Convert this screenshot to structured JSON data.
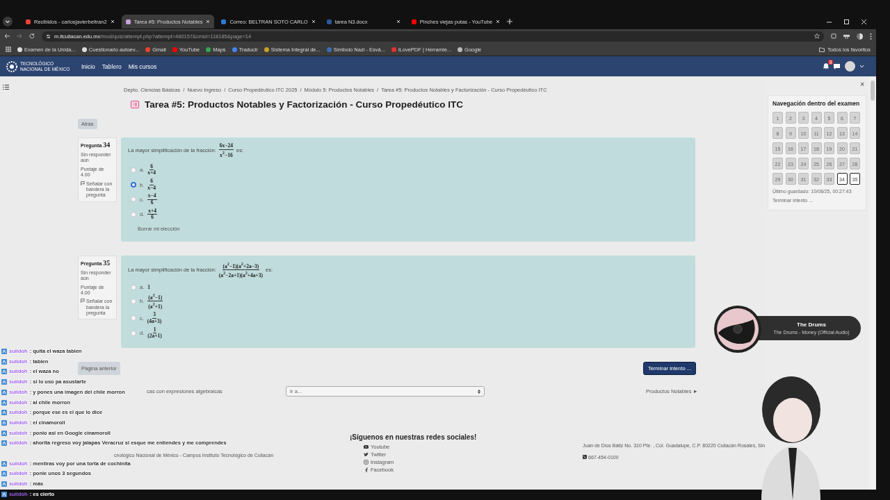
{
  "browser": {
    "tabs": [
      {
        "title": "Recibidos - carlosjavierbeltran2",
        "color": "#ea4335",
        "selected": false
      },
      {
        "title": "Tarea #5: Productos Notables",
        "color": "#c9a0dc",
        "selected": true
      },
      {
        "title": "Correo: BELTRAN SOTO CARLO",
        "color": "#2b7cd3",
        "selected": false
      },
      {
        "title": "tarea N3.docx",
        "color": "#2b579a",
        "selected": false
      },
      {
        "title": "Pinches viejas putas - YouTube",
        "color": "#ff0000",
        "selected": false
      }
    ],
    "url_host": "m.itculiacan.edu.mx",
    "url_path": "/mod/quiz/attempt.php?attempt=480157&cmid=118185&page=14",
    "bookmarks": [
      {
        "label": "Examen de la Unida...",
        "color": "#dddddd"
      },
      {
        "label": "Cuestionario autoev...",
        "color": "#dddddd"
      },
      {
        "label": "Gmail",
        "color": "#ea4335"
      },
      {
        "label": "YouTube",
        "color": "#ff0000"
      },
      {
        "label": "Maps",
        "color": "#34a853"
      },
      {
        "label": "Traducir",
        "color": "#4285f4"
      },
      {
        "label": "Sistema Integral de...",
        "color": "#c8a02a"
      },
      {
        "label": "Símbolo Nazi - Esvá...",
        "color": "#3b6fb6"
      },
      {
        "label": "iLovePDF | Herramie...",
        "color": "#e5322d"
      },
      {
        "label": "Google",
        "color": "#bbbbbb"
      }
    ],
    "all_bookmarks": "Todos los favoritos"
  },
  "site_nav": {
    "logo_text": "TECNOLÓGICO NACIONAL DE MÉXICO",
    "links": [
      "Inicio",
      "Tablero",
      "Mis cursos"
    ],
    "notification_count": "8"
  },
  "breadcrumb": {
    "separator": "/",
    "items": [
      "Depto. Ciencias Básicas",
      "Nuevo Ingreso",
      "Curso Propedéutico ITC 2025",
      "Módulo 5: Productos Notables",
      "Tarea #5: Productos Notables y Factorización - Curso Propedéutico ITC"
    ]
  },
  "page_title": "Tarea #5: Productos Notables y Factorización - Curso Propedéutico ITC",
  "back_button": "Atrás",
  "questions": [
    {
      "label": "Pregunta",
      "number": "34",
      "status": "Sin responder aún",
      "points": "Puntaje de 4.00",
      "flag": "Señalar con bandera la pregunta",
      "prompt": "La mayor simplificación de la fracción:",
      "fraction": {
        "num": "6x−24",
        "den": "x$^{2}$−16"
      },
      "prompt_end": "es:",
      "options": [
        {
          "letter": "a.",
          "kind": "fraction",
          "num": "6",
          "den": "x+4",
          "selected": false
        },
        {
          "letter": "b.",
          "kind": "fraction",
          "num": "6",
          "den": "x−4",
          "selected": true
        },
        {
          "letter": "c.",
          "kind": "fraction",
          "num": "x−4",
          "den": "6",
          "selected": false
        },
        {
          "letter": "d.",
          "kind": "fraction",
          "num": "x+4",
          "den": "6",
          "selected": false
        }
      ],
      "clear_choice": "Borrar mi elección"
    },
    {
      "label": "Pregunta",
      "number": "35",
      "status": "Sin responder aún",
      "points": "Puntaje de 4.00",
      "flag": "Señalar con bandera la pregunta",
      "prompt": "La mayor simplificación de la fracción:",
      "fraction": {
        "num": "(a$^{2}$−1)(a$^{2}$+2a−3)",
        "den": "(a$^{2}$−2a+1)(a$^{2}$+4a+3)"
      },
      "prompt_end": "es:",
      "options": [
        {
          "letter": "a.",
          "kind": "text",
          "text": "1",
          "selected": false
        },
        {
          "letter": "b.",
          "kind": "fraction",
          "num": "(a$^{2}$−1)",
          "den": "(a$^{2}$+1)",
          "selected": false
        },
        {
          "letter": "c.",
          "kind": "fraction",
          "num": "3",
          "den": "(4a+3)",
          "selected": false
        },
        {
          "letter": "d.",
          "kind": "fraction",
          "num": "1",
          "den": "(2a+1)",
          "selected": false
        }
      ]
    }
  ],
  "page_nav": {
    "previous": "Página anterior",
    "finish": "Terminar intento ...",
    "prev_activity": "cas con expresiones algebraicas",
    "jump_menu": {
      "value": "Ir a..."
    },
    "next_activity": "Productos Notables ►"
  },
  "footer": {
    "institution": "cnológico Nacional de México - Campus Instituto Tecnológico de Culiacán",
    "social_title": "¡Síguenos en nuestras redes sociales!",
    "social_links": [
      {
        "label": "Youtube",
        "kind": "youtube"
      },
      {
        "label": "Twitter",
        "kind": "twitter"
      },
      {
        "label": "Instagram",
        "kind": "instagram"
      },
      {
        "label": "Facebook",
        "kind": "facebook"
      }
    ],
    "address": "Juan de Dios Bátiz No. 310 Pte. , Col. Guadalupe, C.P. 80220 Culiacán Rosales, Sin.",
    "phone": "667-454-0100"
  },
  "quiz_navigation": {
    "close": "×",
    "title": "Navegación dentro del examen",
    "questions": [
      {
        "number": "1",
        "selected": false
      },
      {
        "number": "2",
        "selected": false
      },
      {
        "number": "3",
        "selected": false
      },
      {
        "number": "4",
        "selected": false
      },
      {
        "number": "5",
        "selected": false
      },
      {
        "number": "6",
        "selected": false
      },
      {
        "number": "7",
        "selected": false
      },
      {
        "number": "8",
        "selected": false
      },
      {
        "number": "9",
        "selected": false
      },
      {
        "number": "10",
        "selected": false
      },
      {
        "number": "11",
        "selected": false
      },
      {
        "number": "12",
        "selected": false
      },
      {
        "number": "13",
        "selected": false
      },
      {
        "number": "14",
        "selected": false
      },
      {
        "number": "15",
        "selected": false
      },
      {
        "number": "16",
        "selected": false
      },
      {
        "number": "17",
        "selected": false
      },
      {
        "number": "18",
        "selected": false
      },
      {
        "number": "19",
        "selected": false
      },
      {
        "number": "20",
        "selected": false
      },
      {
        "number": "21",
        "selected": false
      },
      {
        "number": "22",
        "selected": false
      },
      {
        "number": "23",
        "selected": false
      },
      {
        "number": "24",
        "selected": false
      },
      {
        "number": "25",
        "selected": false
      },
      {
        "number": "26",
        "selected": false
      },
      {
        "number": "27",
        "selected": false
      },
      {
        "number": "28",
        "selected": false
      },
      {
        "number": "29",
        "selected": false
      },
      {
        "number": "30",
        "selected": false
      },
      {
        "number": "31",
        "selected": false
      },
      {
        "number": "32",
        "selected": false
      },
      {
        "number": "33",
        "selected": false
      },
      {
        "number": "34",
        "selected": true
      },
      {
        "number": "35",
        "selected": true
      }
    ],
    "last_saved": "Último guardado: 10/08/25, 00:27:43",
    "finish_link": "Terminar intento ..."
  },
  "chat": {
    "messages": [
      {
        "user": "suiidoh",
        "text": ": quita el waza tabien"
      },
      {
        "user": "suiidoh",
        "text": ": tabien"
      },
      {
        "user": "suiidoh",
        "text": ": el waza no"
      },
      {
        "user": "suiidoh",
        "text": ": si lo uso pa asustarte"
      },
      {
        "user": "suiidoh",
        "text": ": y pones una imagen del chile morron"
      },
      {
        "user": "suiidoh",
        "text": ": al chile morron"
      },
      {
        "user": "suiidoh",
        "text": ": porque ese es el que lo dice"
      },
      {
        "user": "suiidoh",
        "text": ": el cinamoroll"
      },
      {
        "user": "suiidoh",
        "text": ": ponlo asi en Google cinamoroll"
      },
      {
        "user": "suiidoh",
        "text": ": ahorita regreso voy jalapas Veracruz si esque me entiendes y me comprendes"
      },
      {
        "user": "suiidoh",
        "text": ": mentiras voy por una torta de cochinita"
      },
      {
        "user": "suiidoh",
        "text": ": ponle unos 3 segundos"
      },
      {
        "user": "suiidoh",
        "text": ": más"
      }
    ],
    "latest": {
      "user": "suiidoh",
      "text": ": es cierto"
    }
  },
  "now_playing": {
    "artist": "The Drums",
    "track": "The Drums - Money (Official Audio)"
  }
}
